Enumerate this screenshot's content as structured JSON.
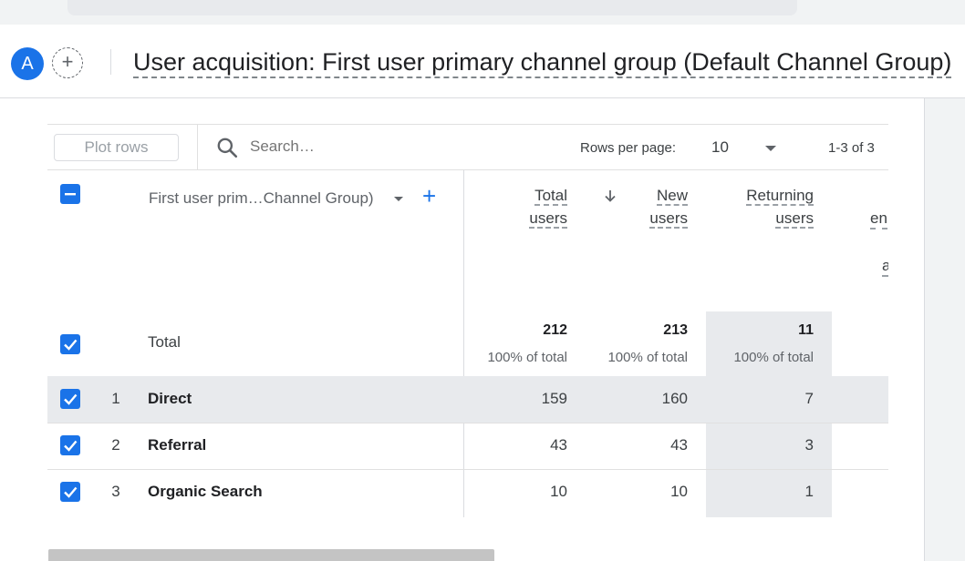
{
  "header": {
    "avatar_letter": "A",
    "add_comparison_symbol": "+",
    "report_title": "User acquisition: First user primary channel group (Default Channel Group)"
  },
  "toolbar": {
    "plot_rows_label": "Plot rows",
    "search_placeholder": "Search…",
    "rows_per_page_label": "Rows per page:",
    "rows_per_page_value": "10",
    "pagination": "1-3 of 3"
  },
  "table": {
    "dimension_header": "First user prim…Channel Group)",
    "add_dimension_symbol": "+",
    "metric_headers": [
      {
        "line1": "Total",
        "line2": "users"
      },
      {
        "line1": "New",
        "line2": "users"
      },
      {
        "line1": "Returning",
        "line2": "users"
      }
    ],
    "partial_header_1": "en",
    "partial_header_2": "a",
    "totals": {
      "label": "Total",
      "values": [
        "212",
        "213",
        "11"
      ],
      "subtext": "100% of total"
    },
    "rows": [
      {
        "index": "1",
        "name": "Direct",
        "values": [
          "159",
          "160",
          "7"
        ]
      },
      {
        "index": "2",
        "name": "Referral",
        "values": [
          "43",
          "43",
          "3"
        ]
      },
      {
        "index": "3",
        "name": "Organic Search",
        "values": [
          "10",
          "10",
          "1"
        ]
      }
    ]
  },
  "colors": {
    "accent": "#1a73e8",
    "highlight_column": "#e8eaed"
  },
  "icons": [
    "search-icon",
    "caret-down-icon",
    "sort-descending-icon",
    "checkbox-checked-icon",
    "checkbox-indeterminate-icon",
    "plus-icon"
  ]
}
